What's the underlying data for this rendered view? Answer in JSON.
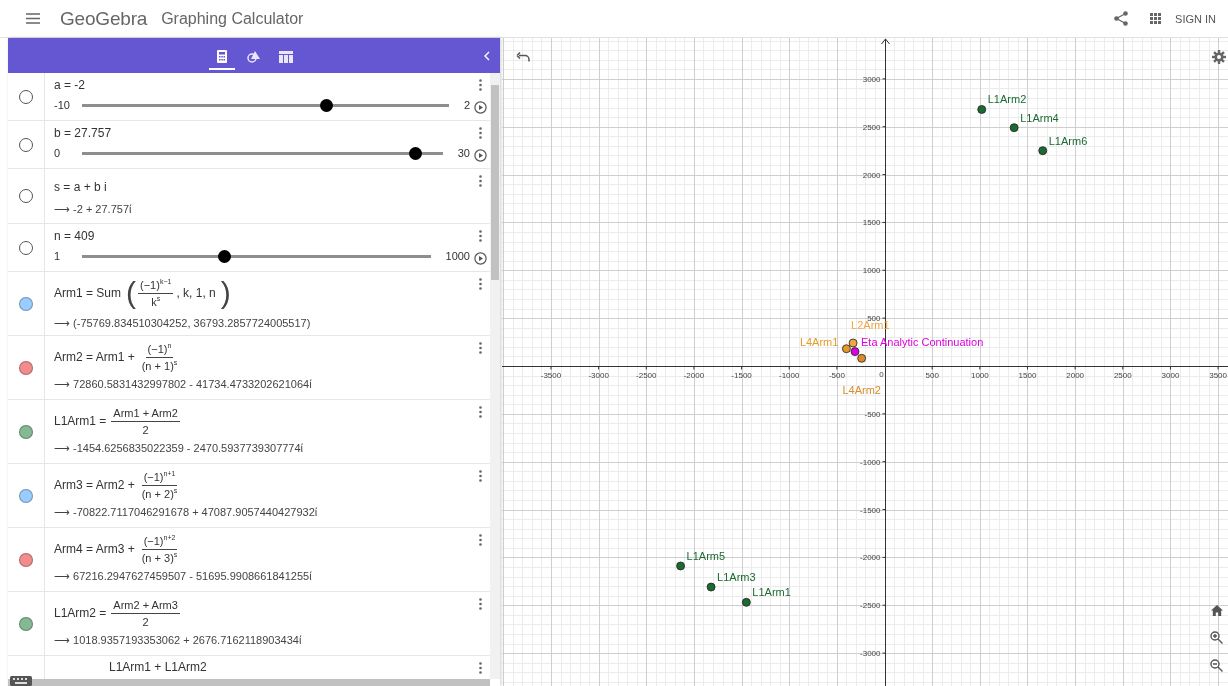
{
  "header": {
    "logo": "GeoGebra",
    "title": "Graphing Calculator",
    "sign_in": "SIGN IN"
  },
  "algebra_tabs": [
    {
      "kind": "algebra",
      "selected": true
    },
    {
      "kind": "tools",
      "selected": false
    },
    {
      "kind": "table",
      "selected": false
    }
  ],
  "algebra_rows": [
    {
      "kind": "slider",
      "visible": false,
      "label": "a = -2",
      "min": "-10",
      "max": "2",
      "level": 0.667
    },
    {
      "kind": "slider",
      "visible": false,
      "label": "b = 27.757",
      "min": "0",
      "max": "30",
      "level": 0.925
    },
    {
      "kind": "expression",
      "visible": false,
      "formula": [
        {
          "kind": "text",
          "text": "s = a + b i"
        }
      ],
      "output": "⟶ -2 + 27.757ί"
    },
    {
      "kind": "slider",
      "visible": false,
      "label": "n = 409",
      "min": "1",
      "max": "1000",
      "level": 0.408
    },
    {
      "kind": "expression",
      "visible": true,
      "color": "#99ccff",
      "formula": [
        {
          "kind": "text",
          "text": "Arm1 = Sum"
        },
        {
          "kind": "paren",
          "text": "("
        },
        {
          "kind": "fraction",
          "num": "(−1)$^{k−1}$",
          "den": "k$^{s}$"
        },
        {
          "kind": "text",
          "text": ", k, 1, n"
        },
        {
          "kind": "paren",
          "text": ")"
        }
      ],
      "output": "⟶ (-75769.834510304252, 36793.2857724005517)"
    },
    {
      "kind": "expression",
      "visible": true,
      "color": "#f28b8b",
      "formula": [
        {
          "kind": "text",
          "text": "Arm2 = Arm1 +"
        },
        {
          "kind": "fraction",
          "num": "(−1)$^{n}$",
          "den": "(n + 1)$^{s}$"
        }
      ],
      "output": "⟶ 72860.5831432997802 - 41734.4733202621064ί"
    },
    {
      "kind": "expression",
      "visible": true,
      "color": "#85b894",
      "formula": [
        {
          "kind": "text",
          "text": "L1Arm1 ="
        },
        {
          "kind": "fraction",
          "num": "Arm1 + Arm2",
          "den": "2"
        }
      ],
      "output": "⟶ -1454.6256835022359 - 2470.5937739307774ί"
    },
    {
      "kind": "expression",
      "visible": true,
      "color": "#99ccff",
      "formula": [
        {
          "kind": "text",
          "text": "Arm3 = Arm2 +"
        },
        {
          "kind": "fraction",
          "num": "(−1)$^{n+1}$",
          "den": "(n + 2)$^{s}$"
        }
      ],
      "output": "⟶ -70822.7117046291678 + 47087.9057440427932ί"
    },
    {
      "kind": "expression",
      "visible": true,
      "color": "#f28b8b",
      "formula": [
        {
          "kind": "text",
          "text": "Arm4 = Arm3 +"
        },
        {
          "kind": "fraction",
          "num": "(−1)$^{n+2}$",
          "den": "(n + 3)$^{s}$"
        }
      ],
      "output": "⟶ 67216.2947627459507 - 51695.9908661841255ί"
    },
    {
      "kind": "expression",
      "visible": true,
      "color": "#85b894",
      "formula": [
        {
          "kind": "text",
          "text": "L1Arm2 ="
        },
        {
          "kind": "fraction",
          "num": "Arm2 + Arm3",
          "den": "2"
        }
      ],
      "output": "⟶ 1018.9357193353062 + 2676.7162118903434ί"
    },
    {
      "kind": "partial",
      "formula": [
        {
          "kind": "text",
          "text": "L1Arm1 + L1Arm2"
        }
      ]
    }
  ],
  "graph": {
    "chart_data": {
      "type": "scatter",
      "xlim": [
        -4014,
        3604
      ],
      "ylim": [
        -3344,
        3427
      ],
      "xticks": [
        -3500,
        -3000,
        -2500,
        -2000,
        -1500,
        -1000,
        -500,
        {
          "value": 0,
          "label": "0"
        },
        500,
        {
          "value": 1000,
          "label": "1000"
        },
        1500,
        2000,
        2500,
        3000,
        3500
      ],
      "yticks": [
        -3000,
        -2500,
        -2000,
        -1500,
        -1000,
        -500,
        500,
        1000,
        1500,
        2000,
        2500,
        3000
      ],
      "grid": true,
      "series": [
        {
          "name": "L1Arm2",
          "color": "#1b6a30",
          "x": [
            1020
          ],
          "values": [
            2680
          ]
        },
        {
          "name": "L1Arm4",
          "color": "#1b6a30",
          "x": [
            1360
          ],
          "values": [
            2490
          ]
        },
        {
          "name": "L1Arm6",
          "color": "#1b6a30",
          "x": [
            1660
          ],
          "values": [
            2250
          ]
        },
        {
          "name": "L1Arm5",
          "color": "#1b6a30",
          "x": [
            -2140
          ],
          "values": [
            -2090
          ]
        },
        {
          "name": "L1Arm3",
          "color": "#1b6a30",
          "x": [
            -1820
          ],
          "values": [
            -2310
          ]
        },
        {
          "name": "L1Arm1",
          "color": "#1b6a30",
          "x": [
            -1450
          ],
          "values": [
            -2470
          ]
        },
        {
          "name": "L4Arm1",
          "color": "#e59a2a",
          "x": [
            -400
          ],
          "values": [
            180
          ]
        },
        {
          "name": "L2Arm1",
          "color": "#f0a640",
          "x": [
            -330
          ],
          "values": [
            240
          ]
        },
        {
          "name": "Eta Analytic Continuation",
          "color": "#dd00dd",
          "x": [
            -310
          ],
          "values": [
            150
          ]
        },
        {
          "name": "L4Arm2",
          "color": "#d98a2b",
          "x": [
            -240
          ],
          "values": [
            80
          ]
        }
      ]
    }
  }
}
